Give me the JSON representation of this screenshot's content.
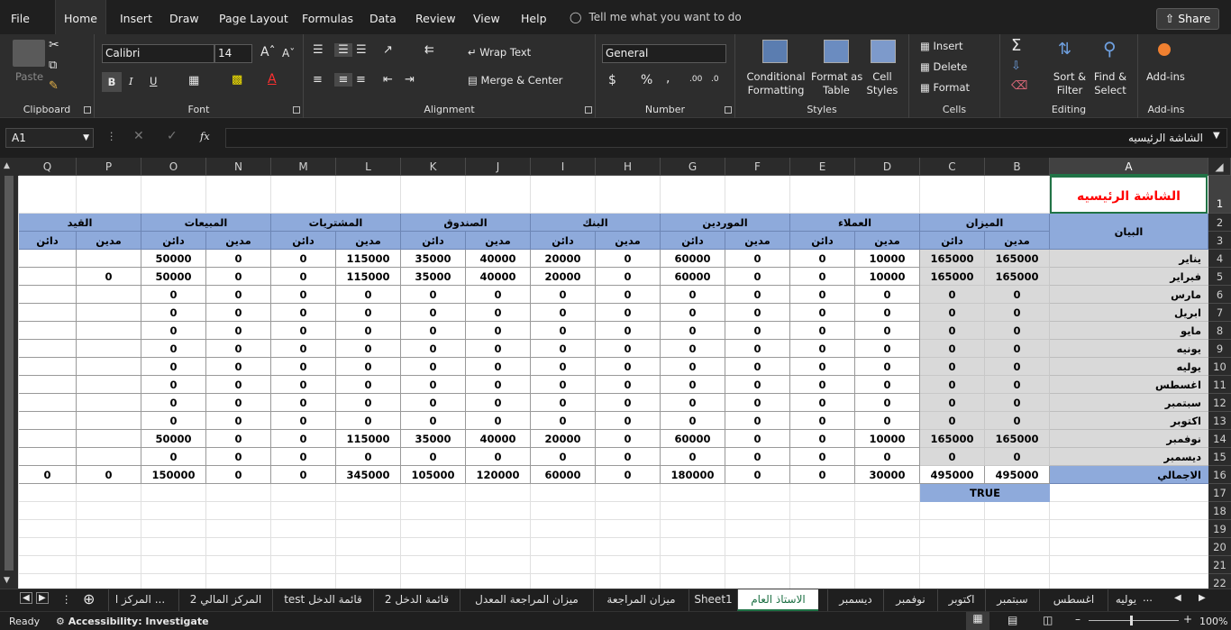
{
  "menu": {
    "tabs": [
      "File",
      "Home",
      "Insert",
      "Draw",
      "Page Layout",
      "Formulas",
      "Data",
      "Review",
      "View",
      "Help"
    ],
    "active": "Home",
    "tell_me": "Tell me what you want to do",
    "share": "Share"
  },
  "ribbon": {
    "clipboard": {
      "label": "Clipboard",
      "paste": "Paste"
    },
    "font": {
      "label": "Font",
      "name": "Calibri",
      "size": "14",
      "bold": "B",
      "italic": "I",
      "underline": "U"
    },
    "alignment": {
      "label": "Alignment",
      "wrap_text": "Wrap Text",
      "merge_center": "Merge & Center"
    },
    "number": {
      "label": "Number",
      "format": "General",
      "currency": "$",
      "percent": "%",
      "comma": ","
    },
    "styles": {
      "label": "Styles",
      "conditional": "Conditional",
      "conditional2": "Formatting",
      "format_as": "Format as",
      "format_as2": "Table",
      "cell": "Cell",
      "cell2": "Styles"
    },
    "cells": {
      "label": "Cells",
      "insert": "Insert",
      "delete": "Delete",
      "format": "Format"
    },
    "editing": {
      "label": "Editing",
      "sort": "Sort &",
      "sort2": "Filter",
      "find": "Find &",
      "find2": "Select"
    },
    "addins": {
      "label": "Add-ins",
      "button": "Add-ins"
    }
  },
  "formula_bar": {
    "name_box": "A1",
    "fx": "fx",
    "content": "الشاشة الرئيسيه"
  },
  "columns": [
    "A",
    "B",
    "C",
    "D",
    "E",
    "F",
    "G",
    "H",
    "I",
    "J",
    "K",
    "L",
    "M",
    "N",
    "O",
    "P",
    "Q"
  ],
  "rows": [
    "1",
    "2",
    "3",
    "4",
    "5",
    "6",
    "7",
    "8",
    "9",
    "10",
    "11",
    "12",
    "13",
    "14",
    "15",
    "16",
    "17",
    "18",
    "19",
    "20",
    "21",
    "22"
  ],
  "sheet": {
    "title": "الشاشة الرئيسيه",
    "label_header": "البيان",
    "groups": [
      "الميزان",
      "العملاء",
      "الموردين",
      "البنك",
      "الصندوق",
      "المشتريات",
      "المبيعات",
      "القيد"
    ],
    "debit": "مدين",
    "credit": "دائن",
    "months": [
      "يناير",
      "فبراير",
      "مارس",
      "ابريل",
      "مايو",
      "يونيه",
      "يوليه",
      "اغسطس",
      "سبتمبر",
      "اكتوبر",
      "نوفمبر",
      "ديسمبر"
    ],
    "total_label": "الاجمالي",
    "data": [
      [
        "165000",
        "165000",
        "10000",
        "0",
        "0",
        "60000",
        "0",
        "20000",
        "40000",
        "35000",
        "115000",
        "0",
        "0",
        "50000",
        "",
        ""
      ],
      [
        "165000",
        "165000",
        "10000",
        "0",
        "0",
        "60000",
        "0",
        "20000",
        "40000",
        "35000",
        "115000",
        "0",
        "0",
        "50000",
        "0",
        ""
      ],
      [
        "0",
        "0",
        "0",
        "0",
        "0",
        "0",
        "0",
        "0",
        "0",
        "0",
        "0",
        "0",
        "0",
        "0",
        "",
        ""
      ],
      [
        "0",
        "0",
        "0",
        "0",
        "0",
        "0",
        "0",
        "0",
        "0",
        "0",
        "0",
        "0",
        "0",
        "0",
        "",
        ""
      ],
      [
        "0",
        "0",
        "0",
        "0",
        "0",
        "0",
        "0",
        "0",
        "0",
        "0",
        "0",
        "0",
        "0",
        "0",
        "",
        ""
      ],
      [
        "0",
        "0",
        "0",
        "0",
        "0",
        "0",
        "0",
        "0",
        "0",
        "0",
        "0",
        "0",
        "0",
        "0",
        "",
        ""
      ],
      [
        "0",
        "0",
        "0",
        "0",
        "0",
        "0",
        "0",
        "0",
        "0",
        "0",
        "0",
        "0",
        "0",
        "0",
        "",
        ""
      ],
      [
        "0",
        "0",
        "0",
        "0",
        "0",
        "0",
        "0",
        "0",
        "0",
        "0",
        "0",
        "0",
        "0",
        "0",
        "",
        ""
      ],
      [
        "0",
        "0",
        "0",
        "0",
        "0",
        "0",
        "0",
        "0",
        "0",
        "0",
        "0",
        "0",
        "0",
        "0",
        "",
        ""
      ],
      [
        "0",
        "0",
        "0",
        "0",
        "0",
        "0",
        "0",
        "0",
        "0",
        "0",
        "0",
        "0",
        "0",
        "0",
        "",
        ""
      ],
      [
        "165000",
        "165000",
        "10000",
        "0",
        "0",
        "60000",
        "0",
        "20000",
        "40000",
        "35000",
        "115000",
        "0",
        "0",
        "50000",
        "",
        ""
      ],
      [
        "0",
        "0",
        "0",
        "0",
        "0",
        "0",
        "0",
        "0",
        "0",
        "0",
        "0",
        "0",
        "0",
        "0",
        "",
        ""
      ]
    ],
    "totals": [
      "495000",
      "495000",
      "30000",
      "0",
      "0",
      "180000",
      "0",
      "60000",
      "120000",
      "105000",
      "345000",
      "0",
      "0",
      "150000",
      "0",
      "0"
    ],
    "check": "TRUE"
  },
  "sheet_tabs": [
    "يوليه",
    "اغسطس",
    "سبتمبر",
    "اكتوبر",
    "نوفمبر",
    "ديسمبر",
    "الاستاذ العام",
    "Sheet1",
    "ميزان المراجعة",
    "ميزان المراجعة المعدل",
    "قائمة الدخل 2",
    "قائمة الدخل test",
    "المركز المالي 2",
    "... المركز ا"
  ],
  "active_sheet": "الاستاذ العام",
  "status": {
    "ready": "Ready",
    "accessibility": "Accessibility: Investigate",
    "zoom": "100%"
  }
}
